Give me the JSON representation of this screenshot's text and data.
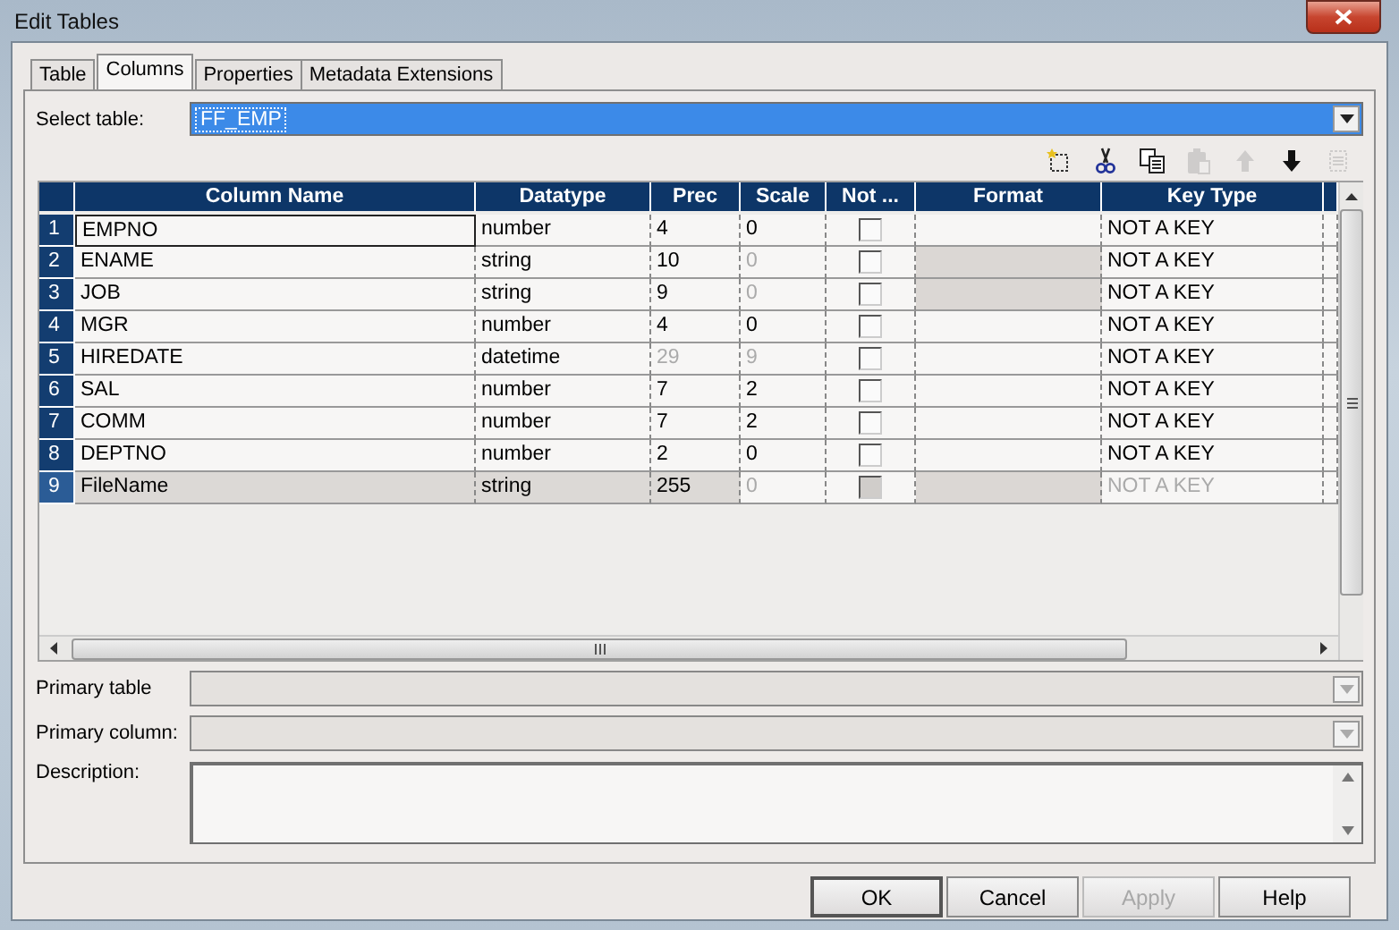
{
  "window": {
    "title": "Edit Tables"
  },
  "tabs": [
    {
      "label": "Table",
      "selected": false
    },
    {
      "label": "Columns",
      "selected": true
    },
    {
      "label": "Properties",
      "selected": false
    },
    {
      "label": "Metadata Extensions",
      "selected": false
    }
  ],
  "select_table": {
    "label": "Select table:",
    "value": "FF_EMP"
  },
  "toolbar": [
    {
      "kind": "new",
      "disabled": false
    },
    {
      "kind": "cut",
      "disabled": false
    },
    {
      "kind": "copy",
      "disabled": false
    },
    {
      "kind": "paste",
      "disabled": true
    },
    {
      "kind": "up",
      "disabled": true
    },
    {
      "kind": "down",
      "disabled": false
    },
    {
      "kind": "delete",
      "disabled": true
    }
  ],
  "grid": {
    "columns": [
      "Column Name",
      "Datatype",
      "Prec",
      "Scale",
      "Not ...",
      "Format",
      "Key Type"
    ],
    "rows": [
      {
        "number": "1",
        "name": "EMPNO",
        "datatype": "number",
        "prec": "4",
        "scale": "0",
        "not_null": false,
        "key_type": "NOT A KEY",
        "selected": false,
        "focused": true,
        "prec_disabled": false,
        "scale_disabled": false,
        "not_null_disabled": false,
        "format_disabled": false,
        "key_disabled": false
      },
      {
        "number": "2",
        "name": "ENAME",
        "datatype": "string",
        "prec": "10",
        "scale": "0",
        "not_null": false,
        "key_type": "NOT A KEY",
        "selected": false,
        "focused": false,
        "prec_disabled": false,
        "scale_disabled": true,
        "not_null_disabled": false,
        "format_disabled": true,
        "key_disabled": false
      },
      {
        "number": "3",
        "name": "JOB",
        "datatype": "string",
        "prec": "9",
        "scale": "0",
        "not_null": false,
        "key_type": "NOT A KEY",
        "selected": false,
        "focused": false,
        "prec_disabled": false,
        "scale_disabled": true,
        "not_null_disabled": false,
        "format_disabled": true,
        "key_disabled": false
      },
      {
        "number": "4",
        "name": "MGR",
        "datatype": "number",
        "prec": "4",
        "scale": "0",
        "not_null": false,
        "key_type": "NOT A KEY",
        "selected": false,
        "focused": false,
        "prec_disabled": false,
        "scale_disabled": false,
        "not_null_disabled": false,
        "format_disabled": false,
        "key_disabled": false
      },
      {
        "number": "5",
        "name": "HIREDATE",
        "datatype": "datetime",
        "prec": "29",
        "scale": "9",
        "not_null": false,
        "key_type": "NOT A KEY",
        "selected": false,
        "focused": false,
        "prec_disabled": true,
        "scale_disabled": true,
        "not_null_disabled": false,
        "format_disabled": false,
        "key_disabled": false
      },
      {
        "number": "6",
        "name": "SAL",
        "datatype": "number",
        "prec": "7",
        "scale": "2",
        "not_null": false,
        "key_type": "NOT A KEY",
        "selected": false,
        "focused": false,
        "prec_disabled": false,
        "scale_disabled": false,
        "not_null_disabled": false,
        "format_disabled": false,
        "key_disabled": false
      },
      {
        "number": "7",
        "name": "COMM",
        "datatype": "number",
        "prec": "7",
        "scale": "2",
        "not_null": false,
        "key_type": "NOT A KEY",
        "selected": false,
        "focused": false,
        "prec_disabled": false,
        "scale_disabled": false,
        "not_null_disabled": false,
        "format_disabled": false,
        "key_disabled": false
      },
      {
        "number": "8",
        "name": "DEPTNO",
        "datatype": "number",
        "prec": "2",
        "scale": "0",
        "not_null": false,
        "key_type": "NOT A KEY",
        "selected": false,
        "focused": false,
        "prec_disabled": false,
        "scale_disabled": false,
        "not_null_disabled": false,
        "format_disabled": false,
        "key_disabled": false
      },
      {
        "number": "9",
        "name": "FileName",
        "datatype": "string",
        "prec": "255",
        "scale": "0",
        "not_null": false,
        "key_type": "NOT A KEY",
        "selected": true,
        "focused": false,
        "prec_disabled": false,
        "scale_disabled": true,
        "not_null_disabled": true,
        "format_disabled": true,
        "key_disabled": true
      }
    ]
  },
  "primary_table": {
    "label": "Primary table",
    "disabled": true
  },
  "primary_column": {
    "label": "Primary column:",
    "disabled": true
  },
  "description": {
    "label": "Description:"
  },
  "buttons": [
    {
      "label": "OK",
      "default": true,
      "disabled": false
    },
    {
      "label": "Cancel",
      "default": false,
      "disabled": false
    },
    {
      "label": "Apply",
      "default": false,
      "disabled": true
    },
    {
      "label": "Help",
      "default": false,
      "disabled": false
    }
  ]
}
